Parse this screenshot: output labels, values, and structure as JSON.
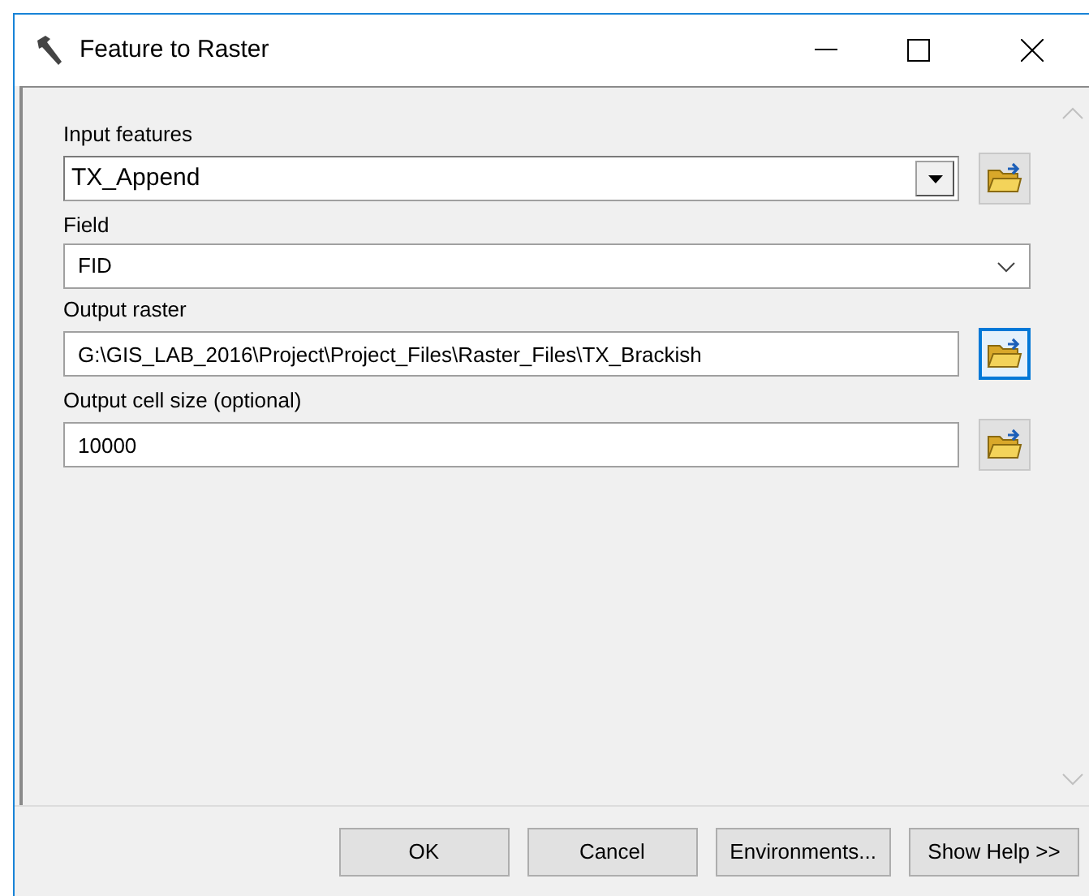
{
  "window": {
    "title": "Feature to Raster"
  },
  "parameters": [
    {
      "label": "Input features",
      "kind": "combo",
      "value": "TX_Append",
      "browse": true,
      "focused": false
    },
    {
      "label": "Field",
      "kind": "dropdown",
      "value": "FID"
    },
    {
      "label": "Output raster",
      "kind": "text",
      "value": "G:\\GIS_LAB_2016\\Project\\Project_Files\\Raster_Files\\TX_Brackish",
      "browse": true,
      "focused": true
    },
    {
      "label": "Output cell size (optional)",
      "kind": "text",
      "value": "10000",
      "browse": true,
      "focused": false
    }
  ],
  "buttons": [
    "OK",
    "Cancel",
    "Environments...",
    "Show Help >>"
  ]
}
